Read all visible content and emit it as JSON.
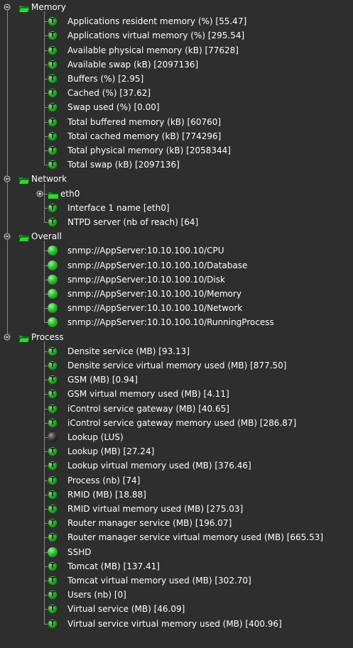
{
  "tree": [
    {
      "kind": "group",
      "label": "Memory",
      "expanded": true,
      "children": [
        {
          "kind": "T",
          "label": "Applications resident memory (%) [55.47]"
        },
        {
          "kind": "T",
          "label": "Applications virtual memory (%) [295.54]"
        },
        {
          "kind": "T",
          "label": "Available physical memory (kB) [77628]"
        },
        {
          "kind": "T",
          "label": "Available swap (kB) [2097136]"
        },
        {
          "kind": "T",
          "label": "Buffers (%) [2.95]"
        },
        {
          "kind": "T",
          "label": "Cached (%) [37.62]"
        },
        {
          "kind": "T",
          "label": "Swap used (%) [0.00]"
        },
        {
          "kind": "T",
          "label": "Total buffered memory (kB) [60760]"
        },
        {
          "kind": "T",
          "label": "Total cached memory (kB) [774296]"
        },
        {
          "kind": "T",
          "label": "Total physical memory (kB) [2058344]"
        },
        {
          "kind": "T",
          "label": "Total swap (kB) [2097136]"
        }
      ]
    },
    {
      "kind": "group",
      "label": "Network",
      "expanded": true,
      "children": [
        {
          "kind": "folder",
          "label": "eth0",
          "expanded": false
        },
        {
          "kind": "T",
          "label": "Interface 1 name [eth0]"
        },
        {
          "kind": "T",
          "label": "NTPD server (nb of reach) [64]"
        }
      ]
    },
    {
      "kind": "group",
      "label": "Overall",
      "expanded": true,
      "children": [
        {
          "kind": "green",
          "label": "snmp://AppServer:10.10.100.10/CPU"
        },
        {
          "kind": "green",
          "label": "snmp://AppServer:10.10.100.10/Database"
        },
        {
          "kind": "green",
          "label": "snmp://AppServer:10.10.100.10/Disk"
        },
        {
          "kind": "green",
          "label": "snmp://AppServer:10.10.100.10/Memory"
        },
        {
          "kind": "green",
          "label": "snmp://AppServer:10.10.100.10/Network"
        },
        {
          "kind": "green",
          "label": "snmp://AppServer:10.10.100.10/RunningProcess"
        }
      ]
    },
    {
      "kind": "group",
      "label": "Process",
      "expanded": true,
      "children": [
        {
          "kind": "T",
          "label": "Densite service (MB) [93.13]"
        },
        {
          "kind": "T",
          "label": "Densite service virtual memory used (MB) [877.50]"
        },
        {
          "kind": "T",
          "label": "GSM (MB) [0.94]"
        },
        {
          "kind": "T",
          "label": "GSM virtual memory used (MB) [4.11]"
        },
        {
          "kind": "T",
          "label": "iControl service gateway (MB) [40.65]"
        },
        {
          "kind": "T",
          "label": "iControl service gateway memory used (MB) [286.87]"
        },
        {
          "kind": "black",
          "label": "Lookup (LUS)"
        },
        {
          "kind": "T",
          "label": "Lookup (MB) [27.24]"
        },
        {
          "kind": "T",
          "label": "Lookup virtual memory used (MB) [376.46]"
        },
        {
          "kind": "T",
          "label": "Process (nb) [74]"
        },
        {
          "kind": "T",
          "label": "RMID (MB) [18.88]"
        },
        {
          "kind": "T",
          "label": "RMID virtual memory used (MB) [275.03]"
        },
        {
          "kind": "T",
          "label": "Router manager service (MB) [196.07]"
        },
        {
          "kind": "T",
          "label": "Router manager service virtual memory used (MB) [665.53]"
        },
        {
          "kind": "green",
          "label": "SSHD"
        },
        {
          "kind": "T",
          "label": "Tomcat (MB) [137.41]"
        },
        {
          "kind": "T",
          "label": "Tomcat virtual memory used (MB) [302.70]"
        },
        {
          "kind": "T",
          "label": "Users (nb) [0]"
        },
        {
          "kind": "T",
          "label": "Virtual service (MB) [46.09]"
        },
        {
          "kind": "T",
          "label": "Virtual service virtual memory used (MB) [400.96]"
        }
      ]
    }
  ],
  "icons": {
    "T": "T"
  },
  "colors": {
    "background": "#2e2e2e",
    "text": "#ffffff",
    "folder": "#2fbf2f",
    "status_ok": "#2fbf2f",
    "status_off": "#1a1a1a",
    "connector": "#8a8a8a"
  }
}
